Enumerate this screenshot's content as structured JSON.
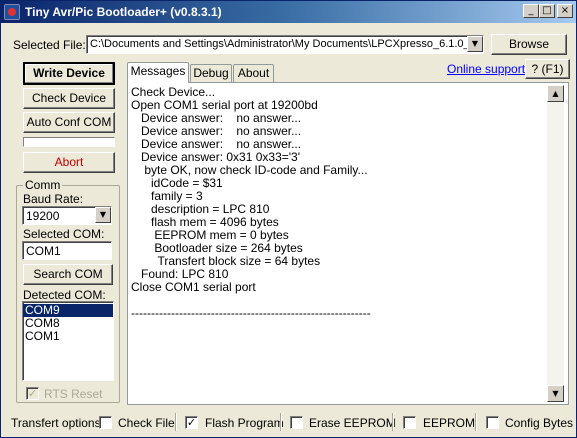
{
  "window": {
    "title": "Tiny Avr/Pic Bootloader+ (v0.8.3.1)",
    "minimize": "_",
    "maximize": "□",
    "close": "×"
  },
  "file": {
    "label": "Selected File:",
    "value": "C:\\Documents and Settings\\Administrator\\My Documents\\LPCXpresso_6.1.0_",
    "browse_label": "Browse"
  },
  "buttons": {
    "write_device": "Write Device",
    "check_device": "Check Device",
    "auto_conf_com": "Auto Conf COM",
    "abort": "Abort",
    "search_com": "Search COM",
    "help": "? (F1)"
  },
  "comm": {
    "group_title": "Comm",
    "baud_label": "Baud Rate:",
    "baud_value": "19200",
    "selected_com_label": "Selected COM:",
    "selected_com_value": "COM1",
    "detected_com_label": "Detected COM:",
    "detected_com": [
      "COM9",
      "COM8",
      "COM1"
    ],
    "rts_reset": "RTS Reset"
  },
  "tabs": [
    "Messages",
    "Debug",
    "About"
  ],
  "online_support": "Online support",
  "log_lines": [
    "Check Device...",
    "Open COM1 serial port at 19200bd",
    "   Device answer:    no answer...",
    "   Device answer:    no answer...",
    "   Device answer:    no answer...",
    "   Device answer: 0x31 0x33='3'",
    "    byte OK, now check ID-code and Family...",
    "      idCode = $31",
    "      family = 3",
    "      description = LPC 810",
    "      flash mem = 4096 bytes",
    "       EEPROM mem = 0 bytes",
    "       Bootloader size = 264 bytes",
    "        Transfert block size = 64 bytes",
    "   Found: LPC 810",
    "Close COM1 serial port",
    "",
    "------------------------------------------------------------"
  ],
  "transfer": {
    "label": "Transfert options:",
    "options": [
      {
        "label": "Check File",
        "checked": false
      },
      {
        "label": "Flash Program",
        "checked": true
      },
      {
        "label": "Erase EEPROM",
        "checked": false
      },
      {
        "label": "EEPROM",
        "checked": false
      },
      {
        "label": "Config Bytes",
        "checked": false
      }
    ]
  },
  "icons": {
    "app": "app-icon",
    "dropdown": "chevron-down-icon",
    "scroll_up": "chevron-up-icon",
    "scroll_down": "chevron-down-icon",
    "check": "checkmark-icon"
  },
  "colors": {
    "title_gradient_start": "#0a246a",
    "title_gradient_end": "#a6caf0",
    "abort_text": "#c00000",
    "link": "#0000ff",
    "selection": "#0a246a"
  }
}
